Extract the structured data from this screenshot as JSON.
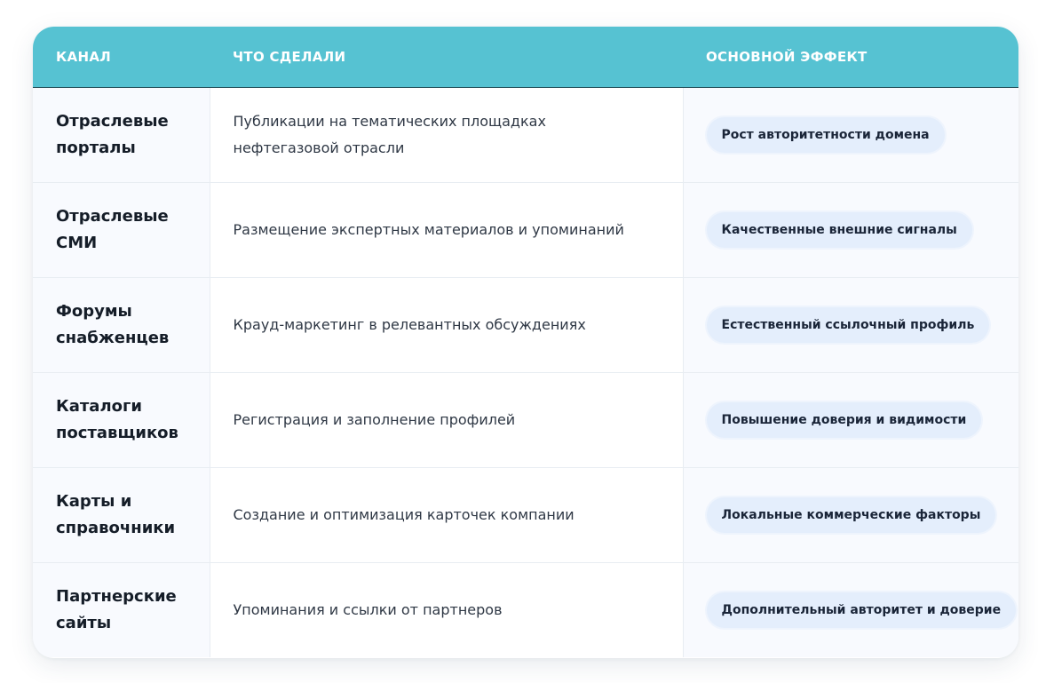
{
  "header": {
    "col_channel": "КАНАЛ",
    "col_action": "ЧТО СДЕЛАЛИ",
    "col_effect": "ОСНОВНОЙ ЭФФЕКТ"
  },
  "rows": [
    {
      "channel": "Отраслевые порталы",
      "action": "Публикации на тематических площадках нефтегазовой отрасли",
      "effect": "Рост авторитетности домена"
    },
    {
      "channel": "Отраслевые СМИ",
      "action": "Размещение экспертных материалов и упоминаний",
      "effect": "Качественные внешние сигналы"
    },
    {
      "channel": "Форумы снабженцев",
      "action": "Крауд-маркетинг в релевантных обсуждениях",
      "effect": "Естественный ссылочный профиль"
    },
    {
      "channel": "Каталоги поставщиков",
      "action": "Регистрация и заполнение профилей",
      "effect": "Повышение доверия и видимости"
    },
    {
      "channel": "Карты и справочники",
      "action": "Создание и оптимизация карточек компании",
      "effect": "Локальные коммерческие факторы"
    },
    {
      "channel": "Партнерские сайты",
      "action": "Упоминания и ссылки от партнеров",
      "effect": "Дополнительный авторитет и доверие"
    }
  ],
  "colors": {
    "header_bg": "#56c2d2",
    "badge_bg": "#e4eefc",
    "text_dark": "#151d28"
  }
}
